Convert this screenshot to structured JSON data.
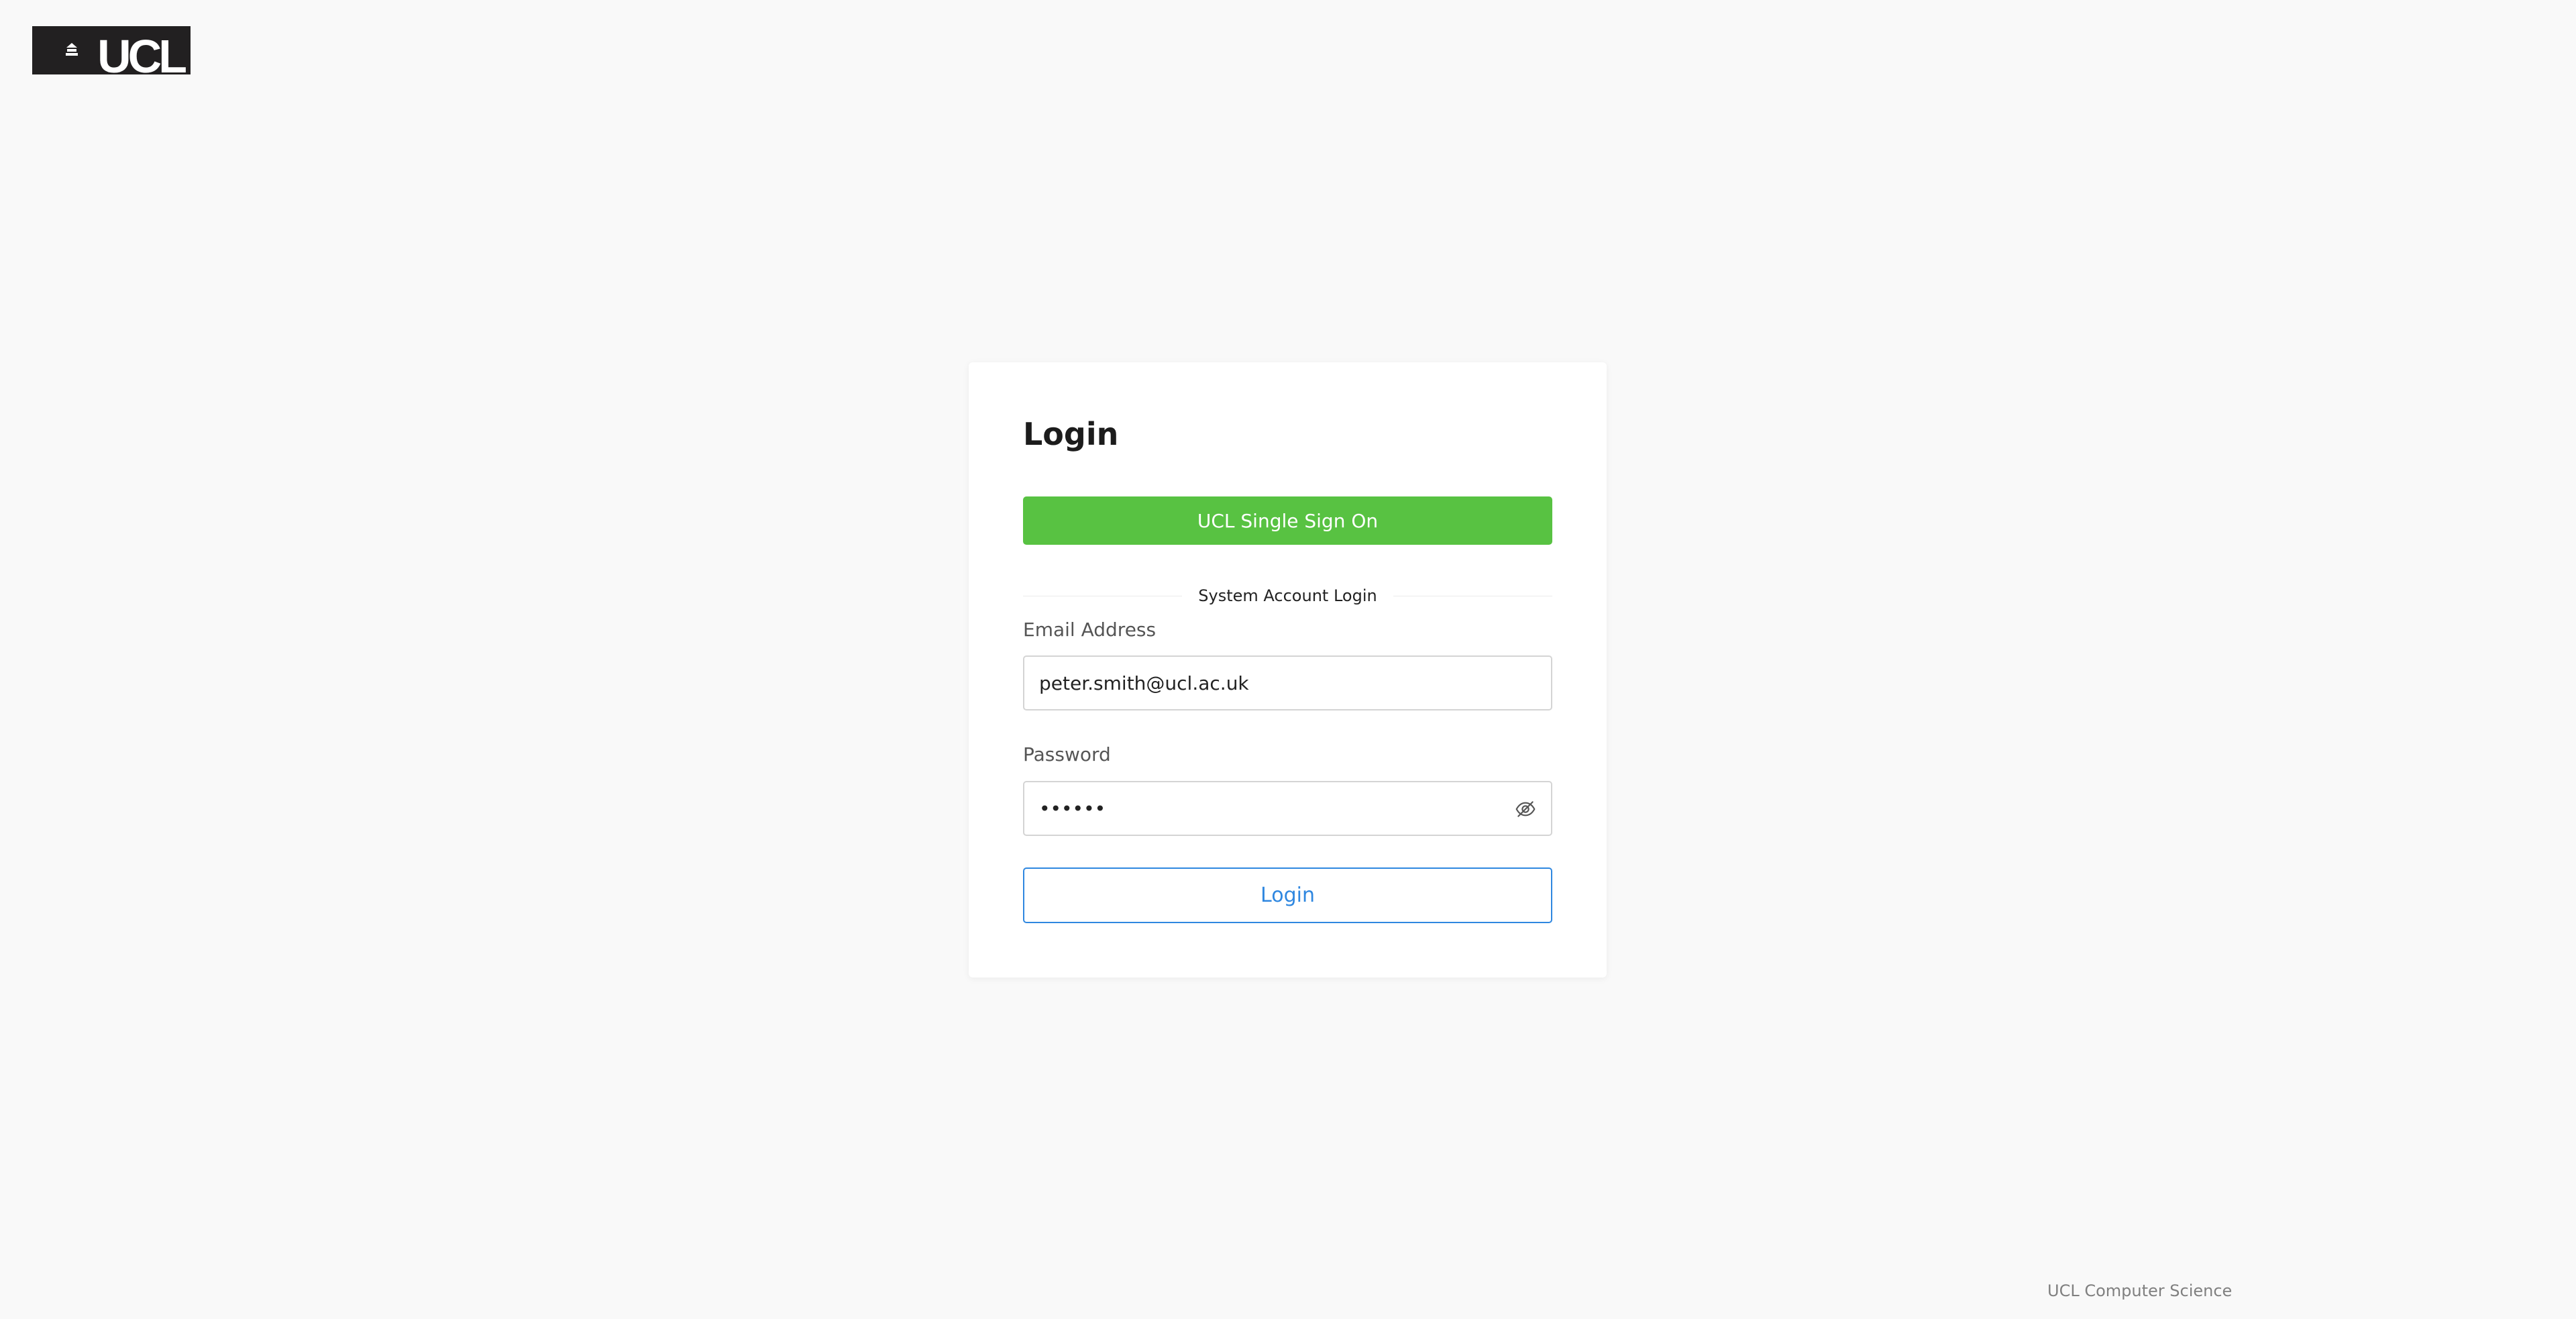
{
  "logo": {
    "text": "UCL",
    "icon": "ucl-portico-icon"
  },
  "login": {
    "title": "Login",
    "sso_button": "UCL Single Sign On",
    "sso_color": "#58c242",
    "divider_text": "System Account Login",
    "email": {
      "label": "Email Address",
      "value": "peter.smith@ucl.ac.uk"
    },
    "password": {
      "label": "Password",
      "value": "••••••",
      "toggle_icon": "eye-slash-icon"
    },
    "login_button": "Login",
    "accent_color": "#2f87e0"
  },
  "footer": {
    "text": "UCL Computer Science"
  }
}
